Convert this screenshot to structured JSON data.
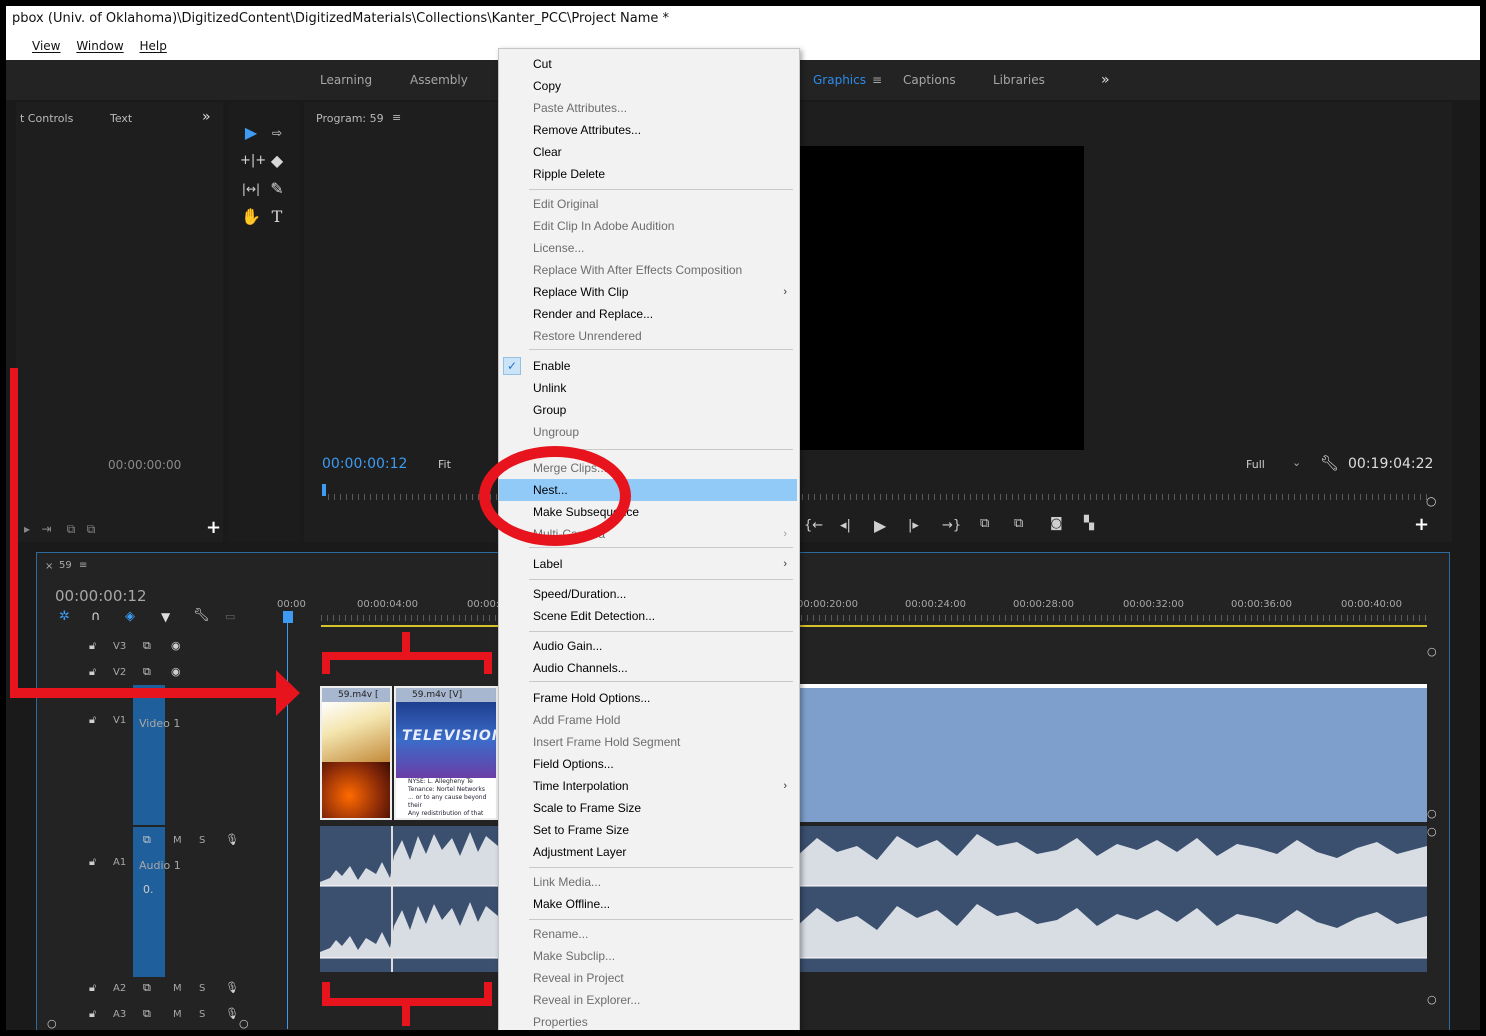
{
  "titlebar": {
    "path": "pbox (Univ. of Oklahoma)\\DigitizedContent\\DigitizedMaterials\\Collections\\Kanter_PCC\\Project Name *"
  },
  "menubar": {
    "items": [
      "View",
      "Window",
      "Help"
    ]
  },
  "workspaces": {
    "learning": "Learning",
    "assembly": "Assembly",
    "graphics": "Graphics",
    "captions": "Captions",
    "libraries": "Libraries",
    "more": "»",
    "menu_icon": "≡"
  },
  "source_panel": {
    "tab_effect_controls": "t Controls",
    "tab_text": "Text",
    "more": "»",
    "timecode": "00:00:00:00"
  },
  "program": {
    "tab": "Program: 59",
    "menu_icon": "≡",
    "timecode": "00:00:00:12",
    "fit": "Fit",
    "quality": "Full",
    "duration": "00:19:04:22"
  },
  "timeline": {
    "tab": "59",
    "menu_icon": "≡",
    "close": "×",
    "timecode": "00:00:00:12",
    "ruler": [
      "00:00",
      "00:00:04:00",
      "00:00:",
      "00:00:20:00",
      "00:00:24:00",
      "00:00:28:00",
      "00:00:32:00",
      "00:00:36:00",
      "00:00:40:00"
    ],
    "tracks": {
      "v3": "V3",
      "v2": "V2",
      "v1": "V1",
      "v1_name": "Video 1",
      "a1": "A1",
      "a1_name": "Audio 1",
      "a2": "A2",
      "a3": "A3",
      "m": "M",
      "s": "S",
      "zero": "0."
    },
    "clips": {
      "clip1": "59.m4v [",
      "clip2": "59.m4v [V]",
      "tv_text": "TELEVISION",
      "caption1": "NYSE:  L. Allegheny Te",
      "caption2": "Tenance: Nortel Networks",
      "caption3": "... or to any cause beyond their",
      "caption4": "Any redistribution of that data is"
    }
  },
  "context_menu": {
    "items": [
      {
        "label": "Cut",
        "disabled": false
      },
      {
        "label": "Copy",
        "disabled": false
      },
      {
        "label": "Paste Attributes...",
        "disabled": true
      },
      {
        "label": "Remove Attributes...",
        "disabled": false
      },
      {
        "label": "Clear",
        "disabled": false
      },
      {
        "label": "Ripple Delete",
        "disabled": false
      },
      {
        "label": "Edit Original",
        "disabled": true
      },
      {
        "label": "Edit Clip In Adobe Audition",
        "disabled": true
      },
      {
        "label": "License...",
        "disabled": true
      },
      {
        "label": "Replace With After Effects Composition",
        "disabled": true
      },
      {
        "label": "Replace With Clip",
        "disabled": false
      },
      {
        "label": "Render and Replace...",
        "disabled": false
      },
      {
        "label": "Restore Unrendered",
        "disabled": true
      },
      {
        "label": "Enable",
        "disabled": false
      },
      {
        "label": "Unlink",
        "disabled": false
      },
      {
        "label": "Group",
        "disabled": false
      },
      {
        "label": "Ungroup",
        "disabled": true
      },
      {
        "label": "Merge Clips...",
        "disabled": true
      },
      {
        "label": "Nest...",
        "disabled": false
      },
      {
        "label": "Make Subsequence",
        "disabled": false
      },
      {
        "label": "Multi-Camera",
        "disabled": true
      },
      {
        "label": "Label",
        "disabled": false
      },
      {
        "label": "Speed/Duration...",
        "disabled": false
      },
      {
        "label": "Scene Edit Detection...",
        "disabled": false
      },
      {
        "label": "Audio Gain...",
        "disabled": false
      },
      {
        "label": "Audio Channels...",
        "disabled": false
      },
      {
        "label": "Frame Hold Options...",
        "disabled": false
      },
      {
        "label": "Add Frame Hold",
        "disabled": true
      },
      {
        "label": "Insert Frame Hold Segment",
        "disabled": true
      },
      {
        "label": "Field Options...",
        "disabled": false
      },
      {
        "label": "Time Interpolation",
        "disabled": false
      },
      {
        "label": "Scale to Frame Size",
        "disabled": false
      },
      {
        "label": "Set to Frame Size",
        "disabled": false
      },
      {
        "label": "Adjustment Layer",
        "disabled": false
      },
      {
        "label": "Link Media...",
        "disabled": true
      },
      {
        "label": "Make Offline...",
        "disabled": false
      },
      {
        "label": "Rename...",
        "disabled": true
      },
      {
        "label": "Make Subclip...",
        "disabled": true
      },
      {
        "label": "Reveal in Project",
        "disabled": true
      },
      {
        "label": "Reveal in Explorer...",
        "disabled": true
      },
      {
        "label": "Properties",
        "disabled": true
      }
    ],
    "submenu_arrow": "›",
    "checkmark": "✓"
  },
  "colors": {
    "accent_blue": "#2d8ceb",
    "annotation_red": "#e8141d",
    "highlight": "#91c9f7"
  }
}
